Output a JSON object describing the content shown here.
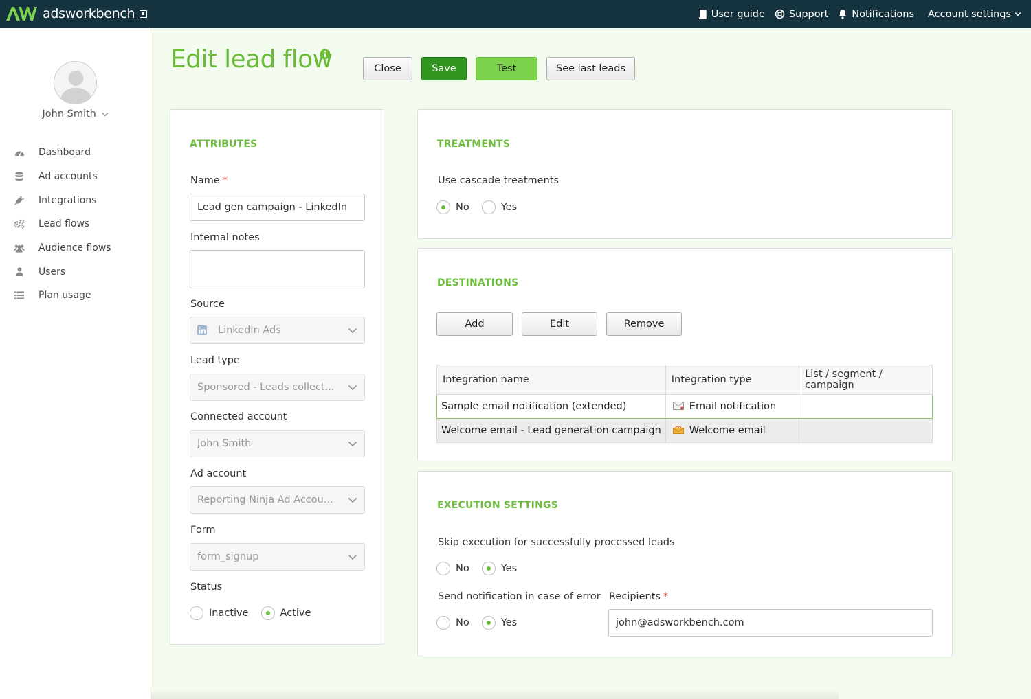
{
  "app": {
    "brand": "adsworkbench"
  },
  "topnav": {
    "user_guide": "User guide",
    "support": "Support",
    "notifications": "Notifications",
    "account_settings": "Account settings"
  },
  "sidebar": {
    "user_name": "John Smith",
    "items": [
      {
        "label": "Dashboard",
        "icon": "dashboard-icon"
      },
      {
        "label": "Ad accounts",
        "icon": "database-icon"
      },
      {
        "label": "Integrations",
        "icon": "plug-icon"
      },
      {
        "label": "Lead flows",
        "icon": "gears-icon"
      },
      {
        "label": "Audience flows",
        "icon": "users-group-icon"
      },
      {
        "label": "Users",
        "icon": "user-icon"
      },
      {
        "label": "Plan usage",
        "icon": "list-icon"
      }
    ]
  },
  "header": {
    "title": "Edit lead flow",
    "buttons": {
      "close": "Close",
      "save": "Save",
      "test": "Test",
      "see_last_leads": "See last leads"
    }
  },
  "attributes": {
    "title": "ATTRIBUTES",
    "name_label": "Name",
    "name_required": "*",
    "name_value": "Lead gen campaign - LinkedIn",
    "notes_label": "Internal notes",
    "notes_value": "",
    "source_label": "Source",
    "source_value": "LinkedIn Ads",
    "lead_type_label": "Lead type",
    "lead_type_value": "Sponsored - Leads collect...",
    "connected_account_label": "Connected account",
    "connected_account_value": "John Smith",
    "ad_account_label": "Ad account",
    "ad_account_value": "Reporting Ninja Ad Accou...",
    "form_label": "Form",
    "form_value": "form_signup",
    "status_label": "Status",
    "status_options": {
      "inactive": "Inactive",
      "active": "Active"
    },
    "status_selected": "active"
  },
  "treatments": {
    "title": "TREATMENTS",
    "cascade_label": "Use cascade treatments",
    "options": {
      "no": "No",
      "yes": "Yes"
    },
    "selected": "no"
  },
  "destinations": {
    "title": "DESTINATIONS",
    "buttons": {
      "add": "Add",
      "edit": "Edit",
      "remove": "Remove"
    },
    "columns": [
      "Integration name",
      "Integration type",
      "List / segment / campaign"
    ],
    "rows": [
      {
        "name": "Sample email notification (extended)",
        "type": "Email notification",
        "type_icon": "envelope-icon",
        "list": ""
      },
      {
        "name": "Welcome email - Lead generation campaign",
        "type": "Welcome email",
        "type_icon": "welcome-mail-icon",
        "list": ""
      }
    ]
  },
  "execution": {
    "title": "EXECUTION SETTINGS",
    "skip_label": "Skip execution for successfully processed leads",
    "skip_selected": "yes",
    "notify_label": "Send notification in case of error",
    "notify_selected": "yes",
    "options": {
      "no": "No",
      "yes": "Yes"
    },
    "recipients_label": "Recipients",
    "recipients_required": "*",
    "recipients_value": "john@adsworkbench.com"
  }
}
